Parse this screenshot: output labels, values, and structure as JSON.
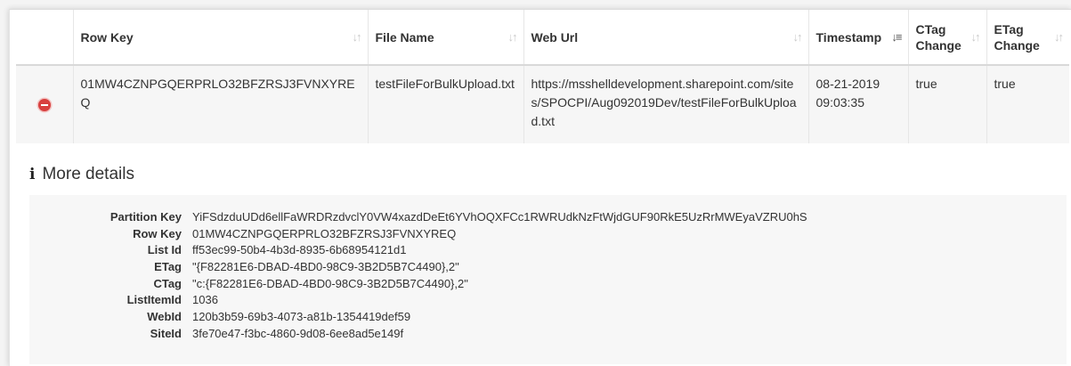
{
  "columns": {
    "row_key": "Row Key",
    "file_name": "File Name",
    "web_url": "Web Url",
    "timestamp": "Timestamp",
    "ctag_change": "CTag Change",
    "etag_change": "ETag Change"
  },
  "row": {
    "row_key": "01MW4CZNPGQERPRLO32BFZRSJ3FVNXYREQ",
    "file_name": "testFileForBulkUpload.txt",
    "web_url": "https://msshelldevelopment.sharepoint.com/sites/SPOCPI/Aug092019Dev/testFileForBulkUpload.txt",
    "timestamp_date": "08-21-2019",
    "timestamp_time": "09:03:35",
    "ctag_change": "true",
    "etag_change": "true"
  },
  "details": {
    "title": "More details",
    "items": [
      {
        "key": "Partition Key",
        "value": "YiFSdzduUDd6ellFaWRDRzdvclY0VW4xazdDeEt6YVhOQXFCc1RWRUdkNzFtWjdGUF90RkE5UzRrMWEyaVZRU0hS"
      },
      {
        "key": "Row Key",
        "value": "01MW4CZNPGQERPRLO32BFZRSJ3FVNXYREQ"
      },
      {
        "key": "List Id",
        "value": "ff53ec99-50b4-4b3d-8935-6b68954121d1"
      },
      {
        "key": "ETag",
        "value": "\"{F82281E6-DBAD-4BD0-98C9-3B2D5B7C4490},2\""
      },
      {
        "key": "CTag",
        "value": "\"c:{F82281E6-DBAD-4BD0-98C9-3B2D5B7C4490},2\""
      },
      {
        "key": "ListItemId",
        "value": "1036"
      },
      {
        "key": "WebId",
        "value": "120b3b59-69b3-4073-a81b-1354419def59"
      },
      {
        "key": "SiteId",
        "value": "3fe70e47-f3bc-4860-9d08-6ee8ad5e149f"
      }
    ]
  },
  "icons": {
    "sort": "sort-icon",
    "sort_desc_active": "sort-desc-icon",
    "remove": "remove-circle-icon",
    "info": "info-icon"
  },
  "colors": {
    "remove_button": "#d8403f",
    "row_background": "#f6f6f6",
    "details_background": "#f7f7f7"
  }
}
